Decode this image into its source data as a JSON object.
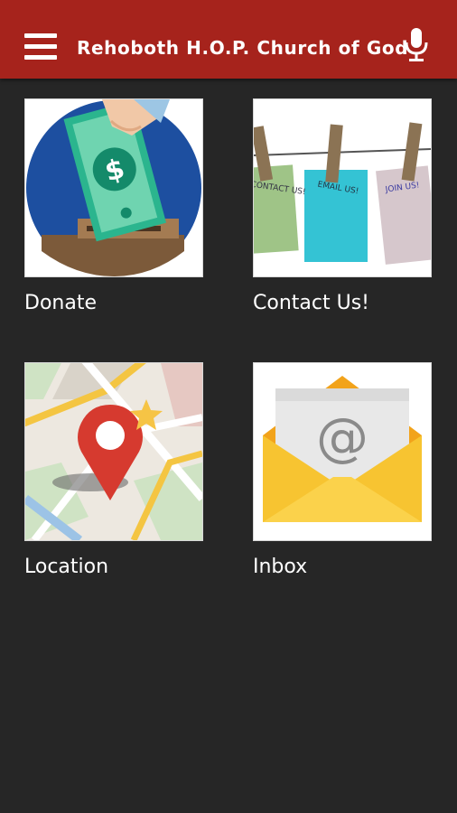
{
  "header": {
    "title": "Rehoboth H.O.P. Church of God",
    "menu_icon": "hamburger-menu-icon",
    "mic_icon": "microphone-icon",
    "background_color": "#a6231c"
  },
  "tiles": [
    {
      "label": "Donate",
      "icon": "donation-money-icon"
    },
    {
      "label": "Contact Us!",
      "icon": "clothesline-notes-icon",
      "notes": [
        "CONTACT US!",
        "EMAIL US!",
        "JOIN US!"
      ]
    },
    {
      "label": "Location",
      "icon": "map-pin-icon"
    },
    {
      "label": "Inbox",
      "icon": "email-envelope-icon"
    }
  ],
  "colors": {
    "page_background": "#262626",
    "text": "#ffffff"
  }
}
